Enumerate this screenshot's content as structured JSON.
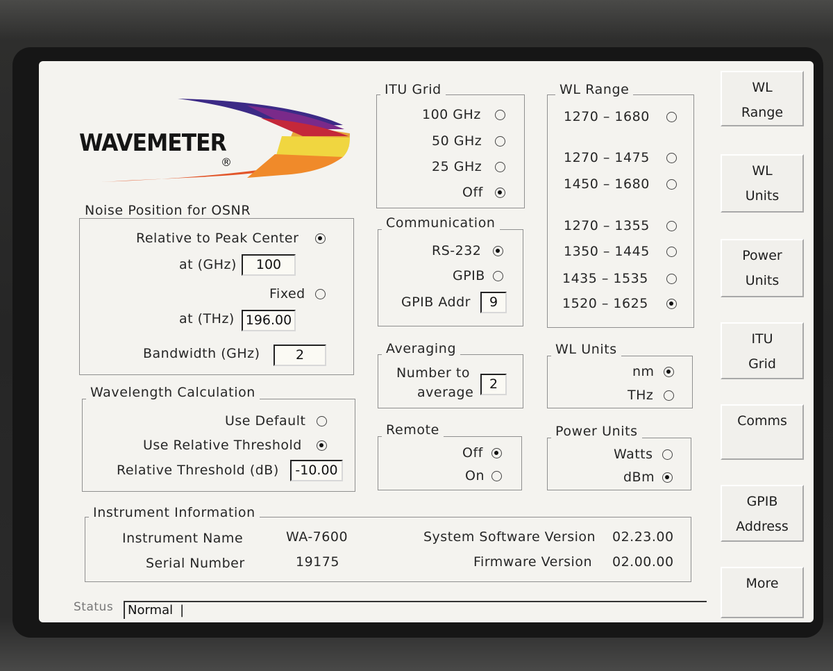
{
  "logo": {
    "text": "WAVEMETER",
    "mark": "®"
  },
  "noise_position": {
    "title": "Noise Position for OSNR",
    "relative_label": "Relative to Peak Center",
    "relative_selected": true,
    "at_ghz_label": "at (GHz)",
    "at_ghz_value": "100",
    "fixed_label": "Fixed",
    "fixed_selected": false,
    "at_thz_label": "at (THz)",
    "at_thz_value": "196.00",
    "bandwidth_label": "Bandwidth (GHz)",
    "bandwidth_value": "2"
  },
  "wavelength_calc": {
    "title": "Wavelength Calculation",
    "use_default_label": "Use Default",
    "use_default_selected": false,
    "use_relative_label": "Use Relative Threshold",
    "use_relative_selected": true,
    "threshold_label": "Relative Threshold (dB)",
    "threshold_value": "-10.00"
  },
  "itu_grid": {
    "title": "ITU Grid",
    "options": [
      {
        "label": "100 GHz",
        "selected": false
      },
      {
        "label": "50 GHz",
        "selected": false
      },
      {
        "label": "25 GHz",
        "selected": false
      },
      {
        "label": "Off",
        "selected": true
      }
    ]
  },
  "communication": {
    "title": "Communication",
    "options": [
      {
        "label": "RS-232",
        "selected": true
      },
      {
        "label": "GPIB",
        "selected": false
      }
    ],
    "gpib_addr_label": "GPIB Addr",
    "gpib_addr_value": "9"
  },
  "averaging": {
    "title": "Averaging",
    "line1": "Number to",
    "line2": "average",
    "value": "2"
  },
  "remote": {
    "title": "Remote",
    "options": [
      {
        "label": "Off",
        "selected": true
      },
      {
        "label": "On",
        "selected": false
      }
    ]
  },
  "wl_range": {
    "title": "WL Range",
    "options": [
      {
        "label": "1270 – 1680",
        "selected": false
      },
      {
        "label": "1270 – 1475",
        "selected": false
      },
      {
        "label": "1450 – 1680",
        "selected": false
      },
      {
        "label": "1270 – 1355",
        "selected": false
      },
      {
        "label": "1350 – 1445",
        "selected": false
      },
      {
        "label": "1435 – 1535",
        "selected": false
      },
      {
        "label": "1520 – 1625",
        "selected": true
      }
    ]
  },
  "wl_units": {
    "title": "WL Units",
    "options": [
      {
        "label": "nm",
        "selected": true
      },
      {
        "label": "THz",
        "selected": false
      }
    ]
  },
  "power_units": {
    "title": "Power Units",
    "options": [
      {
        "label": "Watts",
        "selected": false
      },
      {
        "label": "dBm",
        "selected": true
      }
    ]
  },
  "instrument": {
    "title": "Instrument Information",
    "name_label": "Instrument Name",
    "name_value": "WA-7600",
    "serial_label": "Serial Number",
    "serial_value": "19175",
    "sw_label": "System Software Version",
    "sw_value": "02.23.00",
    "fw_label": "Firmware Version",
    "fw_value": "02.00.00"
  },
  "status": {
    "label": "Status",
    "value": "Normal"
  },
  "side_buttons": [
    {
      "label": "WL\nRange"
    },
    {
      "label": "WL\nUnits"
    },
    {
      "label": "Power\nUnits"
    },
    {
      "label": "ITU\nGrid"
    },
    {
      "label": "Comms"
    },
    {
      "label": "GPIB\nAddress"
    },
    {
      "label": "More"
    }
  ]
}
